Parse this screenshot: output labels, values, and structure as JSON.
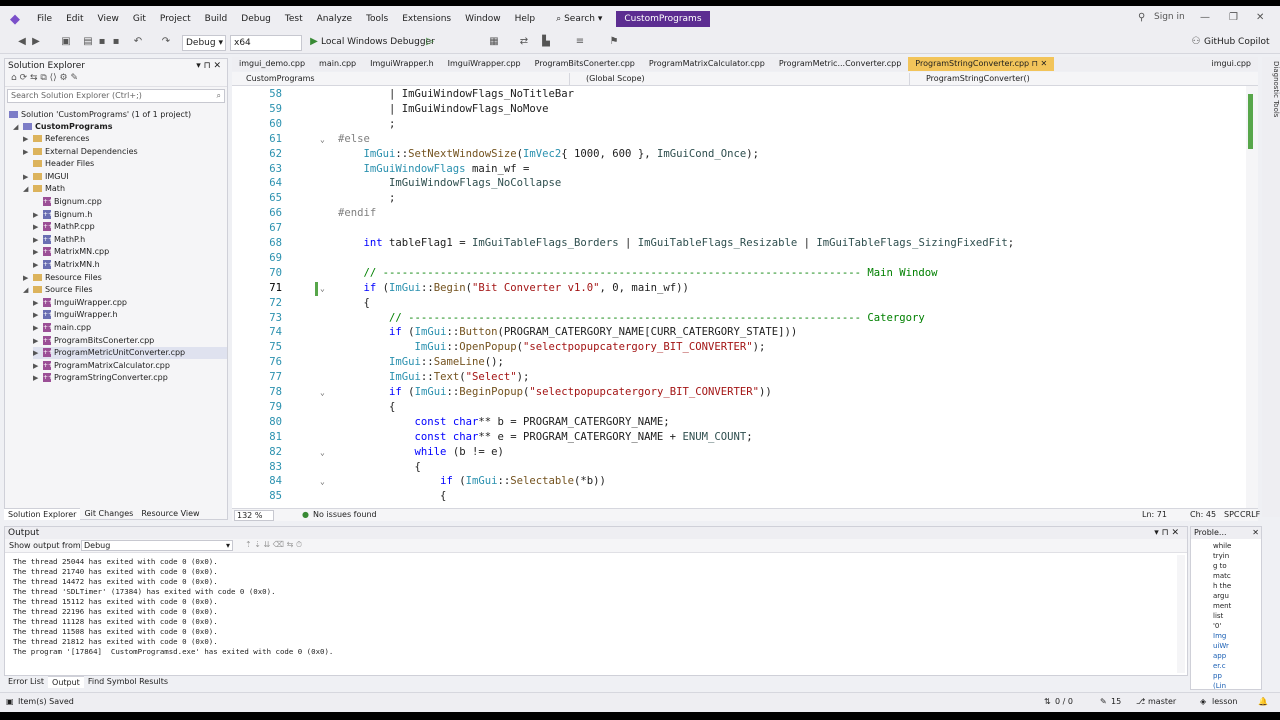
{
  "menubar": {
    "items": [
      "File",
      "Edit",
      "View",
      "Git",
      "Project",
      "Build",
      "Debug",
      "Test",
      "Analyze",
      "Tools",
      "Extensions",
      "Window",
      "Help"
    ],
    "search_label": "Search",
    "solution_title": "CustomPrograms",
    "sign_in": "Sign in"
  },
  "toolbar": {
    "config": "Debug",
    "platform": "x64",
    "run_label": "Local Windows Debugger",
    "copilot": "GitHub Copilot"
  },
  "solution_explorer": {
    "title": "Solution Explorer",
    "search_placeholder": "Search Solution Explorer (Ctrl+;)",
    "solution": "Solution 'CustomPrograms' (1 of 1 project)",
    "project": "CustomPrograms",
    "items": [
      {
        "label": "References",
        "indent": 2,
        "type": "folder-ref",
        "arrow": "▶"
      },
      {
        "label": "External Dependencies",
        "indent": 2,
        "type": "folder",
        "arrow": "▶"
      },
      {
        "label": "Header Files",
        "indent": 2,
        "type": "folder",
        "arrow": ""
      },
      {
        "label": "IMGUI",
        "indent": 2,
        "type": "folder",
        "arrow": "▶"
      },
      {
        "label": "Math",
        "indent": 2,
        "type": "folder",
        "arrow": "◢"
      },
      {
        "label": "Bignum.cpp",
        "indent": 3,
        "type": "cpp",
        "arrow": ""
      },
      {
        "label": "Bignum.h",
        "indent": 3,
        "type": "h",
        "arrow": "▶"
      },
      {
        "label": "MathP.cpp",
        "indent": 3,
        "type": "cpp",
        "arrow": "▶"
      },
      {
        "label": "MathP.h",
        "indent": 3,
        "type": "h",
        "arrow": "▶"
      },
      {
        "label": "MatrixMN.cpp",
        "indent": 3,
        "type": "cpp",
        "arrow": "▶"
      },
      {
        "label": "MatrixMN.h",
        "indent": 3,
        "type": "h",
        "arrow": "▶"
      },
      {
        "label": "Resource Files",
        "indent": 2,
        "type": "folder",
        "arrow": "▶"
      },
      {
        "label": "Source Files",
        "indent": 2,
        "type": "folder",
        "arrow": "◢"
      },
      {
        "label": "ImguiWrapper.cpp",
        "indent": 3,
        "type": "cpp",
        "arrow": "▶"
      },
      {
        "label": "ImguiWrapper.h",
        "indent": 3,
        "type": "h",
        "arrow": "▶"
      },
      {
        "label": "main.cpp",
        "indent": 3,
        "type": "cpp",
        "arrow": "▶"
      },
      {
        "label": "ProgramBitsConerter.cpp",
        "indent": 3,
        "type": "cpp",
        "arrow": "▶"
      },
      {
        "label": "ProgramMetricUnitConverter.cpp",
        "indent": 3,
        "type": "cpp",
        "arrow": "▶",
        "selected": true
      },
      {
        "label": "ProgramMatrixCalculator.cpp",
        "indent": 3,
        "type": "cpp",
        "arrow": "▶"
      },
      {
        "label": "ProgramStringConverter.cpp",
        "indent": 3,
        "type": "cpp",
        "arrow": "▶"
      }
    ],
    "tabs": [
      "Solution Explorer",
      "Git Changes",
      "Resource View"
    ]
  },
  "doc_tabs": [
    "imgui_demo.cpp",
    "main.cpp",
    "ImguiWrapper.h",
    "ImguiWrapper.cpp",
    "ProgramBitsConerter.cpp",
    "ProgramMatrixCalculator.cpp",
    "ProgramMetric...Converter.cpp",
    "ProgramStringConverter.cpp",
    "imgui.cpp"
  ],
  "active_doc_tab": "ProgramStringConverter.cpp",
  "navbar": {
    "project": "CustomPrograms",
    "scope": "(Global Scope)",
    "member": "ProgramStringConverter()"
  },
  "editor": {
    "zoom": "132 %",
    "issues": "No issues found",
    "ln": "Ln: 71",
    "ch": "Ch: 45",
    "spc": "SPC",
    "crlf": "CRLF",
    "lines": [
      {
        "n": "58",
        "fold": "",
        "html": "        | ImGuiWindowFlags_NoTitleBar"
      },
      {
        "n": "59",
        "fold": "",
        "html": "        | ImGuiWindowFlags_NoMove"
      },
      {
        "n": "60",
        "fold": "",
        "html": "        ;"
      },
      {
        "n": "61",
        "fold": "⌄",
        "html": "<span class='pp'>#else</span>"
      },
      {
        "n": "62",
        "fold": "",
        "html": "    <span class='ns'>ImGui</span>::<span class='fn'>SetNextWindowSize</span>(<span class='ty'>ImVec2</span>{ 1000, 600 }, <span class='en'>ImGuiCond_Once</span>);"
      },
      {
        "n": "63",
        "fold": "",
        "html": "    <span class='ty'>ImGuiWindowFlags</span> main_wf ="
      },
      {
        "n": "64",
        "fold": "",
        "html": "        <span class='en'>ImGuiWindowFlags_NoCollapse</span>"
      },
      {
        "n": "65",
        "fold": "",
        "html": "        ;"
      },
      {
        "n": "66",
        "fold": "",
        "html": "<span class='pp'>#endif</span>"
      },
      {
        "n": "67",
        "fold": "",
        "html": ""
      },
      {
        "n": "68",
        "fold": "",
        "html": "    <span class='kw'>int</span> tableFlag1 = <span class='en'>ImGuiTableFlags_Borders</span> | <span class='en'>ImGuiTableFlags_Resizable</span> | <span class='en'>ImGuiTableFlags_SizingFixedFit</span>;"
      },
      {
        "n": "69",
        "fold": "",
        "html": ""
      },
      {
        "n": "70",
        "fold": "",
        "html": "    <span class='cm'>// --------------------------------------------------------------------------- Main Window</span>"
      },
      {
        "n": "71",
        "fold": "⌄",
        "html": "    <span class='kw'>if</span> (<span class='ns'>ImGui</span>::<span class='fn'>Begin</span>(<span class='str'>\"Bit Converter v1.0\"</span>, 0, main_wf))"
      },
      {
        "n": "72",
        "fold": "",
        "html": "    {"
      },
      {
        "n": "73",
        "fold": "",
        "html": "        <span class='cm'>// ----------------------------------------------------------------------- Catergory</span>"
      },
      {
        "n": "74",
        "fold": "",
        "html": "        <span class='kw'>if</span> (<span class='ns'>ImGui</span>::<span class='fn'>Button</span>(PROGRAM_CATERGORY_NAME[CURR_CATERGORY_STATE]))"
      },
      {
        "n": "75",
        "fold": "",
        "html": "            <span class='ns'>ImGui</span>::<span class='fn'>OpenPopup</span>(<span class='str'>\"selectpopupcatergory_BIT_CONVERTER\"</span>);"
      },
      {
        "n": "76",
        "fold": "",
        "html": "        <span class='ns'>ImGui</span>::<span class='fn'>SameLine</span>();"
      },
      {
        "n": "77",
        "fold": "",
        "html": "        <span class='ns'>ImGui</span>::<span class='fn'>Text</span>(<span class='str'>\"Select\"</span>);"
      },
      {
        "n": "78",
        "fold": "⌄",
        "html": "        <span class='kw'>if</span> (<span class='ns'>ImGui</span>::<span class='fn'>BeginPopup</span>(<span class='str'>\"selectpopupcatergory_BIT_CONVERTER\"</span>))"
      },
      {
        "n": "79",
        "fold": "",
        "html": "        {"
      },
      {
        "n": "80",
        "fold": "",
        "html": "            <span class='kw'>const</span> <span class='kw'>char</span>** b = PROGRAM_CATERGORY_NAME;"
      },
      {
        "n": "81",
        "fold": "",
        "html": "            <span class='kw'>const</span> <span class='kw'>char</span>** e = PROGRAM_CATERGORY_NAME + <span class='en'>ENUM_COUNT</span>;"
      },
      {
        "n": "82",
        "fold": "⌄",
        "html": "            <span class='kw'>while</span> (b != e)"
      },
      {
        "n": "83",
        "fold": "",
        "html": "            {"
      },
      {
        "n": "84",
        "fold": "⌄",
        "html": "                <span class='kw'>if</span> (<span class='ns'>ImGui</span>::<span class='fn'>Selectable</span>(*b))"
      },
      {
        "n": "85",
        "fold": "",
        "html": "                {"
      }
    ]
  },
  "output": {
    "title": "Output",
    "show_from_label": "Show output from:",
    "show_from_value": "Debug",
    "lines": [
      "The thread 25044 has exited with code 0 (0x0).",
      "The thread 21740 has exited with code 0 (0x0).",
      "The thread 14472 has exited with code 0 (0x0).",
      "The thread 'SDLTimer' (17384) has exited with code 0 (0x0).",
      "The thread 15112 has exited with code 0 (0x0).",
      "The thread 22196 has exited with code 0 (0x0).",
      "The thread 11128 has exited with code 0 (0x0).",
      "The thread 11508 has exited with code 0 (0x0).",
      "The thread 21812 has exited with code 0 (0x0).",
      "The program '[17864]  CustomProgramsd.exe' has exited with code 0 (0x0)."
    ]
  },
  "problems": {
    "title": "Proble...",
    "lines": [
      {
        "t": "while",
        "link": false
      },
      {
        "t": "tryin",
        "link": false
      },
      {
        "t": "g to",
        "link": false
      },
      {
        "t": "matc",
        "link": false
      },
      {
        "t": "h the",
        "link": false
      },
      {
        "t": "argu",
        "link": false
      },
      {
        "t": "ment",
        "link": false
      },
      {
        "t": "list",
        "link": false
      },
      {
        "t": "'0'",
        "link": false
      },
      {
        "t": "Img",
        "link": true
      },
      {
        "t": "uiWr",
        "link": true
      },
      {
        "t": "app",
        "link": true
      },
      {
        "t": "er.c",
        "link": true
      },
      {
        "t": "pp",
        "link": true
      },
      {
        "t": "(Lin",
        "link": true
      }
    ]
  },
  "bottom_tabs": [
    "Error List",
    "Output",
    "Find Symbol Results"
  ],
  "statusbar": {
    "saved": "Item(s) Saved",
    "arrows": "0 / 0",
    "edits": "15",
    "branch": "master",
    "repo": "lesson"
  },
  "colors": {
    "accent_tab": "#f2c45a",
    "vs_purple": "#5c2d91",
    "change_green": "#57a64a"
  }
}
